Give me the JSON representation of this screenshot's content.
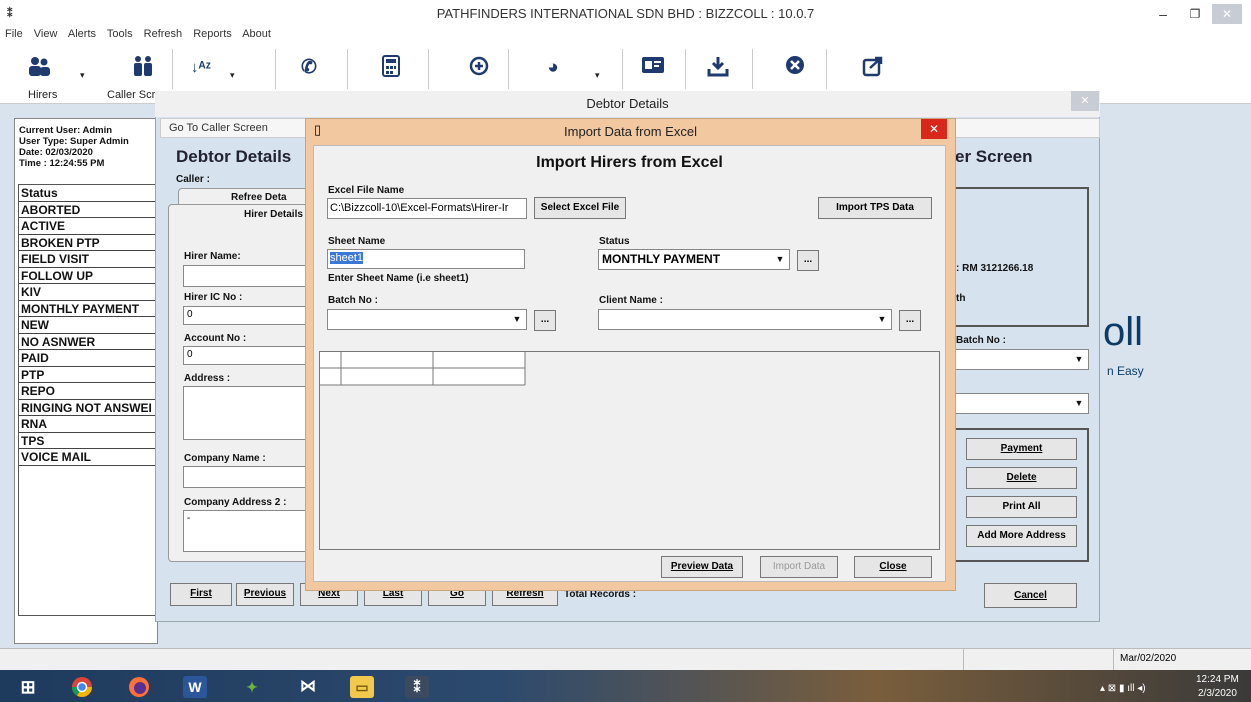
{
  "window": {
    "title": "PATHFINDERS INTERNATIONAL SDN BHD  :  BIZZCOLL  : 10.0.7",
    "min": "–",
    "max": "❐",
    "close": "✕"
  },
  "menu": [
    "File",
    "View",
    "Alerts",
    "Tools",
    "Refresh",
    "Reports",
    "About"
  ],
  "toolbar": {
    "hirers_label": "Hirers",
    "caller_label": "Caller Scre",
    "drop": "▾"
  },
  "left_panel": {
    "current_user": "Current User: Admin",
    "user_type": "User Type: Super Admin",
    "date": "Date: 02/03/2020",
    "time": "Time : 12:24:55 PM",
    "status_items": [
      "Status",
      "ABORTED",
      "ACTIVE",
      "BROKEN PTP",
      "FIELD VISIT",
      "FOLLOW UP",
      "KIV",
      "MONTHLY PAYMENT",
      "NEW",
      "NO ASNWER",
      "PAID",
      "PTP",
      "REPO",
      "RINGING NOT ANSWEI",
      "RNA",
      "TPS",
      "VOICE MAIL"
    ]
  },
  "debtor": {
    "title": "Debtor Details",
    "close": "✕",
    "go_caller": "Go To Caller Screen",
    "heading": "Debtor Details",
    "caller_label": "Caller :",
    "tab_refree": "Refree Deta",
    "tab_hirer": "Hirer Details",
    "hirer_name_label": "Hirer Name:",
    "hirer_ic_label": "Hirer IC No :",
    "hirer_ic_value": "0",
    "account_label": "Account No :",
    "account_value": "0",
    "address_label": "Address :",
    "company_label": "Company Name :",
    "company_addr_label": "Company Address 2 :",
    "company_addr_value": "-",
    "er_screen": "er Screen",
    "amount": ": RM 3121266.18",
    "th": "th",
    "batch_label": "Batch No :",
    "logo": "oll",
    "logo_sub": "n Easy",
    "btn_payment": "Payment",
    "btn_delete": "Delete",
    "btn_print_all": "Print All",
    "btn_add_more": "Add More Address",
    "btn_cancel": "Cancel",
    "btn_first": "First",
    "btn_previous": "Previous",
    "btn_next": "Next",
    "btn_last": "Last",
    "btn_go": "Go",
    "btn_refresh": "Refresh",
    "total_records": "Total Records :"
  },
  "import": {
    "title": "Import Data from Excel",
    "close": "✕",
    "heading": "Import Hirers from Excel",
    "excel_file_label": "Excel File Name",
    "excel_file_value": "C:\\Bizzcoll-10\\Excel-Formats\\Hirer-Ir",
    "select_btn": "Select Excel File",
    "import_tps_btn": "Import TPS Data",
    "sheet_label": "Sheet Name",
    "sheet_value": "sheet1",
    "sheet_hint": "Enter Sheet Name (i.e  sheet1)",
    "status_label": "Status",
    "status_value": "MONTHLY PAYMENT",
    "batch_label": "Batch No :",
    "client_label": "Client Name :",
    "ellipsis": "...",
    "preview_btn": "Preview Data",
    "import_btn": "Import Data",
    "close_btn": "Close"
  },
  "statusbar": {
    "date": "Mar/02/2020"
  },
  "taskbar": {
    "time": "12:24 PM",
    "date": "2/3/2020"
  }
}
